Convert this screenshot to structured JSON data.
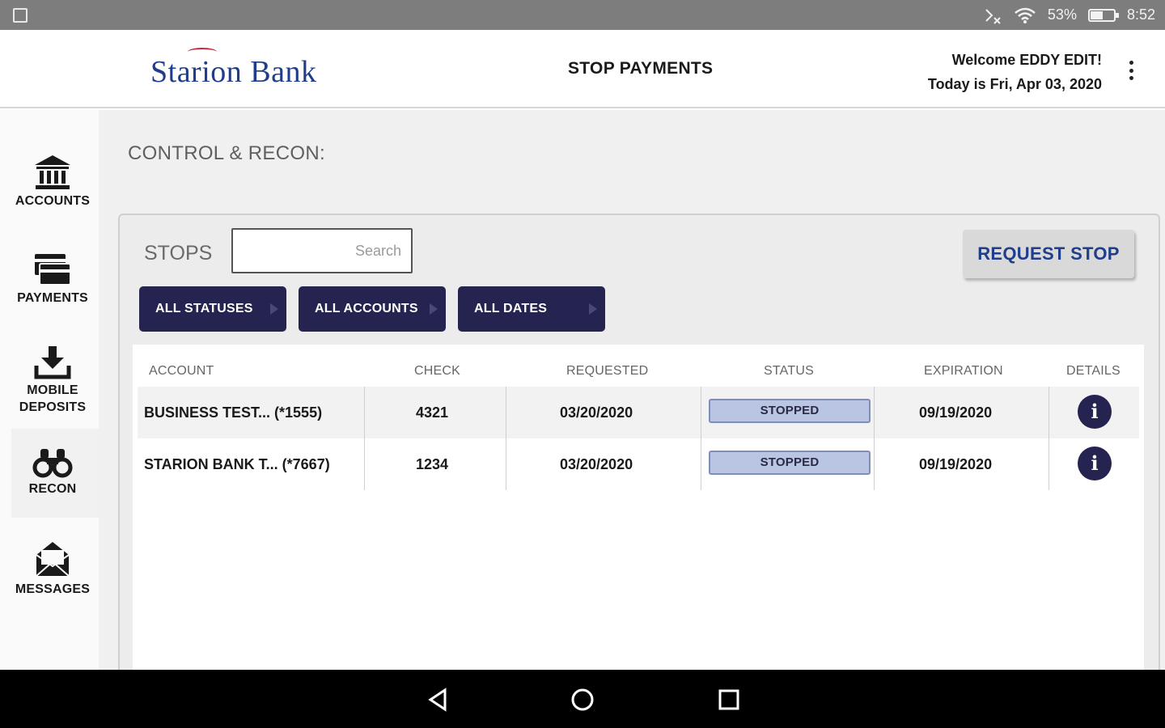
{
  "status_bar": {
    "battery": "53%",
    "time": "8:52",
    "battery_level": 0.53
  },
  "header": {
    "logo_text": "Starion Bank",
    "page_title": "STOP PAYMENTS",
    "welcome": "Welcome EDDY EDIT!",
    "date_line": "Today is Fri, Apr 03, 2020"
  },
  "sidebar": {
    "items": [
      {
        "label": "ACCOUNTS",
        "icon": "bank-icon"
      },
      {
        "label": "PAYMENTS",
        "icon": "payments-icon"
      },
      {
        "label": "MOBILE DEPOSITS",
        "icon": "deposit-icon"
      },
      {
        "label": "RECON",
        "icon": "binoculars-icon"
      },
      {
        "label": "MESSAGES",
        "icon": "envelope-icon"
      }
    ]
  },
  "main": {
    "section_title": "CONTROL & RECON:",
    "stops_label": "STOPS",
    "search_placeholder": "Search",
    "request_stop_label": "REQUEST STOP",
    "filters": [
      "ALL STATUSES",
      "ALL ACCOUNTS",
      "ALL DATES"
    ]
  },
  "table": {
    "columns": [
      "ACCOUNT",
      "CHECK",
      "REQUESTED",
      "STATUS",
      "EXPIRATION",
      "DETAILS"
    ],
    "rows": [
      {
        "account": "BUSINESS TEST... (*1555)",
        "check": "4321",
        "requested": "03/20/2020",
        "status": "STOPPED",
        "expiration": "09/19/2020"
      },
      {
        "account": "STARION BANK T... (*7667)",
        "check": "1234",
        "requested": "03/20/2020",
        "status": "STOPPED",
        "expiration": "09/19/2020"
      }
    ]
  },
  "colors": {
    "brand_navy": "#25234f",
    "brand_blue": "#1f3d8a",
    "status_badge": "#b9c5e2"
  }
}
